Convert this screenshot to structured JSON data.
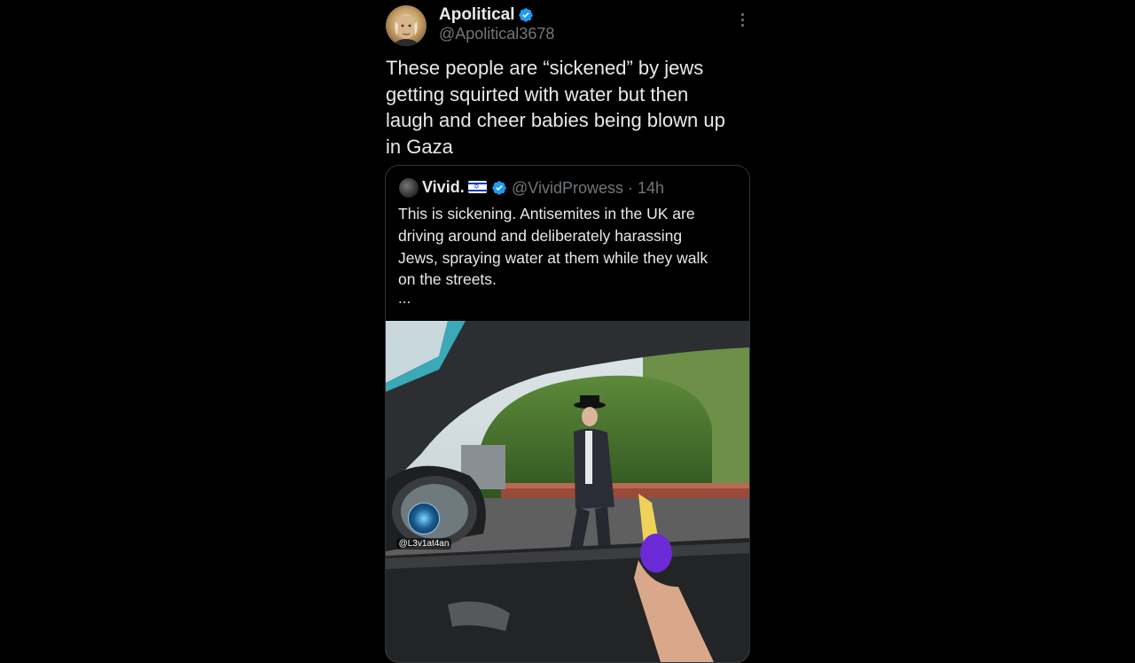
{
  "tweet": {
    "author": {
      "display_name": "Apolitical",
      "handle": "@Apolitical3678",
      "verified": true
    },
    "text": "These people are “sickened” by jews\ngetting squirted with water but then\nlaugh and cheer babies being blown up\nin Gaza",
    "more_icon": "more-vertical-icon"
  },
  "quote": {
    "display_name": "Vivid.",
    "flag_icon": "israel-flag-icon",
    "verified": true,
    "handle_time": "@VividProwess · 14h",
    "text": "This is sickening. Antisemites in the UK are\ndriving around and deliberately harassing\nJews, spraying water at them while they walk\non the streets.",
    "ellipsis": "...",
    "media": {
      "type": "video-still",
      "watermark": "@L3v1at4an"
    }
  },
  "colors": {
    "background": "#000000",
    "text": "#e7e9ea",
    "muted": "#71767b",
    "verified": "#1d9bf0",
    "border": "#2f3336"
  }
}
